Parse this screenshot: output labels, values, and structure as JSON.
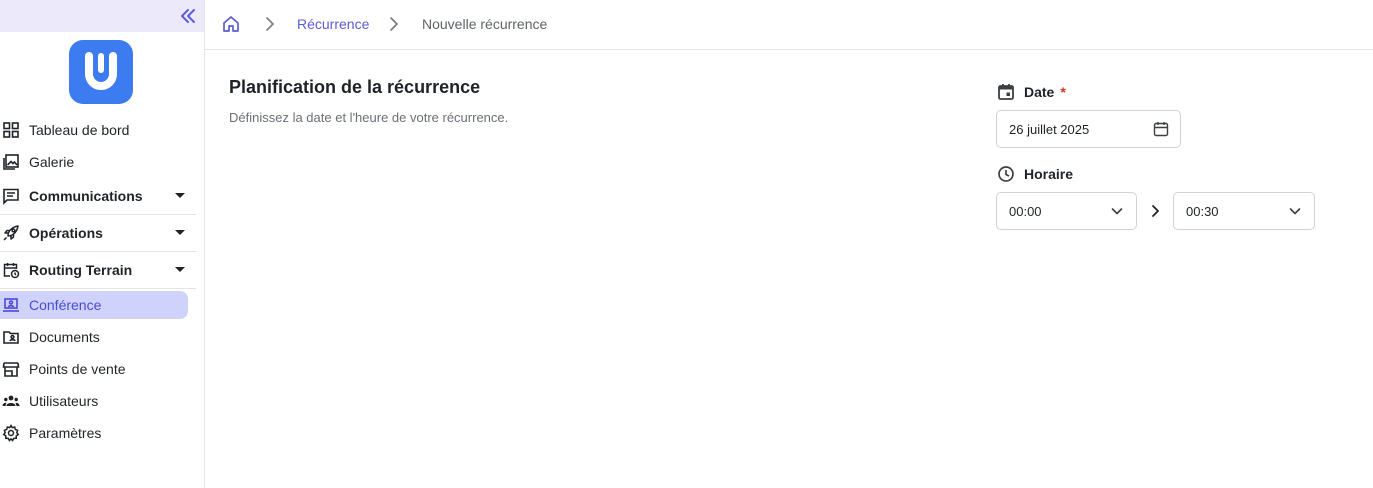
{
  "sidebar": {
    "items": [
      {
        "label": "Tableau de bord",
        "icon": "grid-icon"
      },
      {
        "label": "Galerie",
        "icon": "gallery-icon"
      },
      {
        "label": "Communications",
        "icon": "chat-icon"
      },
      {
        "label": "Opérations",
        "icon": "rocket-icon"
      },
      {
        "label": "Routing Terrain",
        "icon": "calendar-clock-icon"
      },
      {
        "label": "Conférence",
        "icon": "laptop-user-icon"
      },
      {
        "label": "Documents",
        "icon": "folder-user-icon"
      },
      {
        "label": "Points de vente",
        "icon": "store-icon"
      },
      {
        "label": "Utilisateurs",
        "icon": "users-icon"
      },
      {
        "label": "Paramètres",
        "icon": "gear-icon"
      }
    ],
    "active_item": "Conférence"
  },
  "breadcrumb": {
    "items": [
      "Récurrence",
      "Nouvelle récurrence"
    ]
  },
  "main": {
    "title": "Planification de la récurrence",
    "subtitle": "Définissez la date et l'heure de votre récurrence.",
    "date": {
      "label": "Date",
      "required_mark": "*",
      "value": "26 juillet 2025"
    },
    "schedule": {
      "label": "Horaire",
      "start": "00:00",
      "end": "00:30"
    }
  },
  "colors": {
    "accent": "#5b5bd6",
    "active_bg": "#cfd3fb",
    "collapse_bg": "#ece9fb",
    "logo": "#3d7cf0",
    "required": "#d93025"
  }
}
